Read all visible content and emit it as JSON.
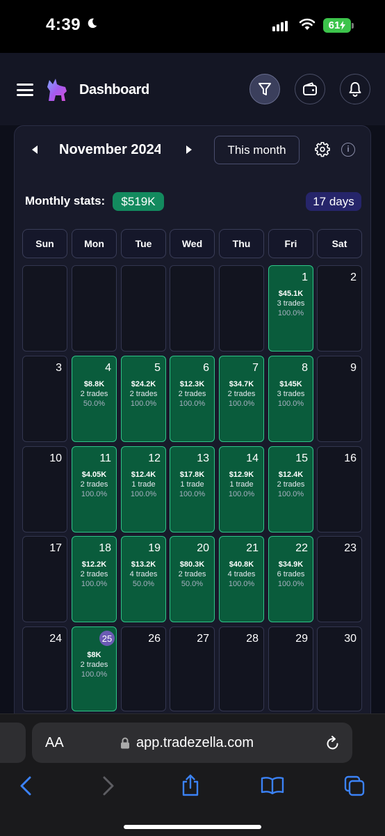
{
  "status": {
    "time": "4:39",
    "battery": "61"
  },
  "header": {
    "title": "Dashboard"
  },
  "calendar": {
    "month": "November 2024",
    "this_month_label": "This month",
    "monthly_stats_label": "Monthly stats:",
    "monthly_pnl": "$519K",
    "days_badge": "17 days",
    "weekdays": [
      "Sun",
      "Mon",
      "Tue",
      "Wed",
      "Thu",
      "Fri",
      "Sat"
    ],
    "weeks": [
      [
        {
          "day": ""
        },
        {
          "day": ""
        },
        {
          "day": ""
        },
        {
          "day": ""
        },
        {
          "day": ""
        },
        {
          "day": "1",
          "pnl": "$45.1K",
          "trades": "3 trades",
          "rate": "100.0%"
        },
        {
          "day": "2"
        }
      ],
      [
        {
          "day": "3"
        },
        {
          "day": "4",
          "pnl": "$8.8K",
          "trades": "2 trades",
          "rate": "50.0%"
        },
        {
          "day": "5",
          "pnl": "$24.2K",
          "trades": "2 trades",
          "rate": "100.0%"
        },
        {
          "day": "6",
          "pnl": "$12.3K",
          "trades": "2 trades",
          "rate": "100.0%"
        },
        {
          "day": "7",
          "pnl": "$34.7K",
          "trades": "2 trades",
          "rate": "100.0%"
        },
        {
          "day": "8",
          "pnl": "$145K",
          "trades": "3 trades",
          "rate": "100.0%"
        },
        {
          "day": "9"
        }
      ],
      [
        {
          "day": "10"
        },
        {
          "day": "11",
          "pnl": "$4.05K",
          "trades": "2 trades",
          "rate": "100.0%"
        },
        {
          "day": "12",
          "pnl": "$12.4K",
          "trades": "1 trade",
          "rate": "100.0%"
        },
        {
          "day": "13",
          "pnl": "$17.8K",
          "trades": "1 trade",
          "rate": "100.0%"
        },
        {
          "day": "14",
          "pnl": "$12.9K",
          "trades": "1 trade",
          "rate": "100.0%"
        },
        {
          "day": "15",
          "pnl": "$12.4K",
          "trades": "2 trades",
          "rate": "100.0%"
        },
        {
          "day": "16"
        }
      ],
      [
        {
          "day": "17"
        },
        {
          "day": "18",
          "pnl": "$12.2K",
          "trades": "2 trades",
          "rate": "100.0%"
        },
        {
          "day": "19",
          "pnl": "$13.2K",
          "trades": "4 trades",
          "rate": "50.0%"
        },
        {
          "day": "20",
          "pnl": "$80.3K",
          "trades": "2 trades",
          "rate": "50.0%"
        },
        {
          "day": "21",
          "pnl": "$40.8K",
          "trades": "4 trades",
          "rate": "100.0%"
        },
        {
          "day": "22",
          "pnl": "$34.9K",
          "trades": "6 trades",
          "rate": "100.0%"
        },
        {
          "day": "23"
        }
      ],
      [
        {
          "day": "24"
        },
        {
          "day": "25",
          "pnl": "$8K",
          "trades": "2 trades",
          "rate": "100.0%",
          "today": true
        },
        {
          "day": "26"
        },
        {
          "day": "27"
        },
        {
          "day": "28"
        },
        {
          "day": "29"
        },
        {
          "day": "30"
        }
      ]
    ]
  },
  "browser": {
    "aa_label": "AA",
    "url": "app.tradezella.com"
  },
  "colors": {
    "profit_cell": "#0a5c3c",
    "profit_border": "#2fc488",
    "stats_badge": "#138a5e",
    "days_badge": "#26256a",
    "today_circle": "#6b5bb4",
    "browser_accent": "#3b82f6"
  }
}
